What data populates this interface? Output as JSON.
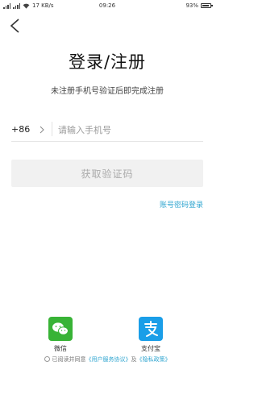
{
  "status_bar": {
    "network": "17 KB/s",
    "time": "09:26",
    "battery": "93%",
    "battery_level": 0.93
  },
  "header": {
    "back_icon": "chevron-left-icon"
  },
  "title": "登录/注册",
  "subtitle": "未注册手机号验证后即完成注册",
  "phone": {
    "country_code": "+86",
    "value": "",
    "placeholder": "请输入手机号"
  },
  "get_code_button": "获取验证码",
  "password_login_link": "账号密码登录",
  "social_login": [
    {
      "label": "微信",
      "icon": "wechat-icon",
      "color": "#38b336"
    },
    {
      "label": "支付宝",
      "icon": "alipay-icon",
      "color": "#1a9ee8"
    }
  ],
  "agreement": {
    "prefix": "已阅读并同意",
    "user_agreement": "《用户服务协议》",
    "connector": "及",
    "privacy_policy": "《隐私政策》"
  },
  "colors": {
    "accent": "#2fa5d0",
    "button_disabled_bg": "#f1f1f1",
    "button_disabled_text": "#aaaaaa"
  }
}
